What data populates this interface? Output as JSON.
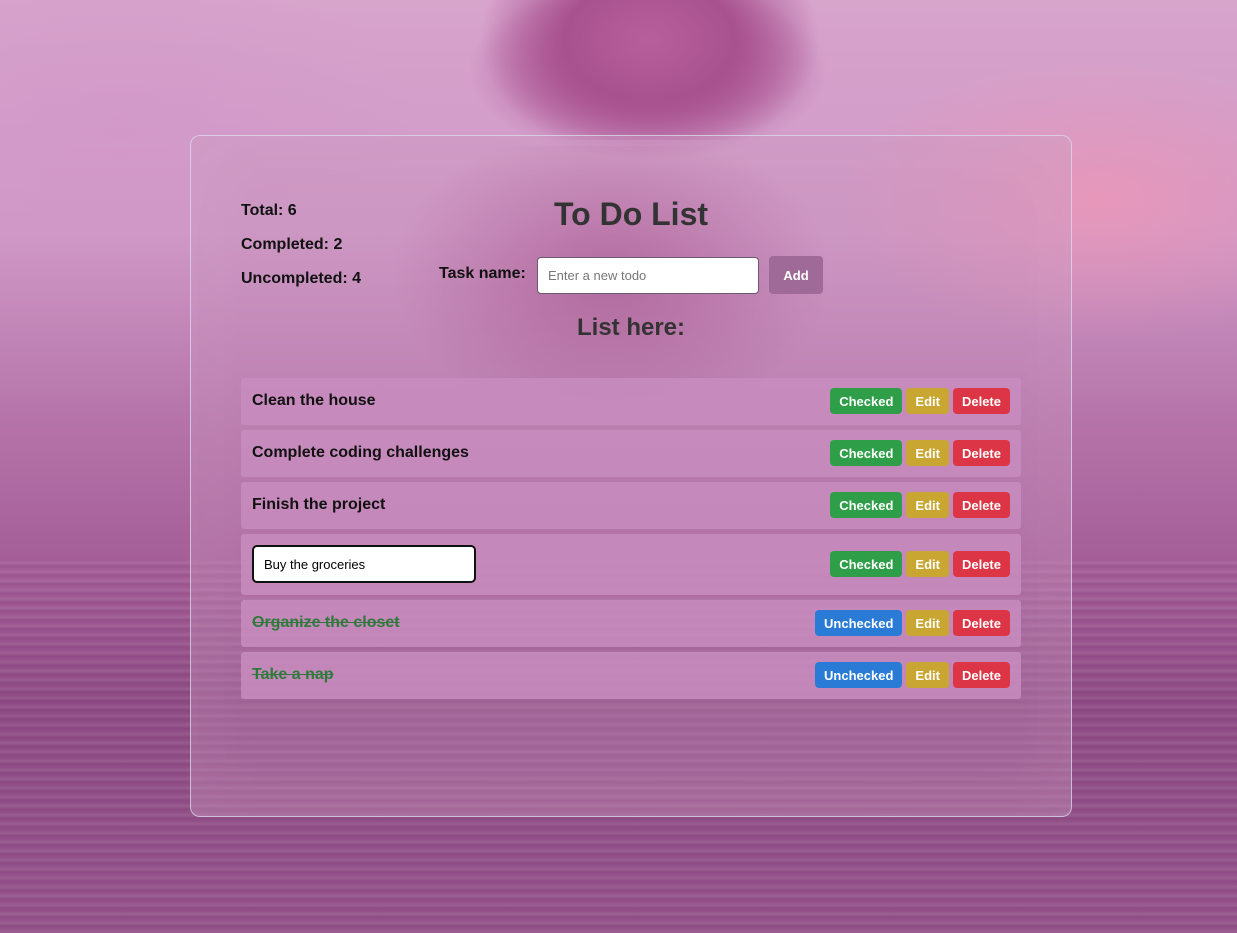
{
  "stats": {
    "total": "Total: 6",
    "completed": "Completed: 2",
    "uncompleted": "Uncompleted: 4"
  },
  "title": "To Do List",
  "form": {
    "label": "Task name:",
    "placeholder": "Enter a new todo",
    "value": "",
    "add_label": "Add"
  },
  "list_heading": "List here:",
  "todos": [
    {
      "text": "Clean the house",
      "done": false,
      "editing": false,
      "toggle_label": "Checked",
      "edit_label": "Edit",
      "delete_label": "Delete"
    },
    {
      "text": "Complete coding challenges",
      "done": false,
      "editing": false,
      "toggle_label": "Checked",
      "edit_label": "Edit",
      "delete_label": "Delete"
    },
    {
      "text": "Finish the project",
      "done": false,
      "editing": false,
      "toggle_label": "Checked",
      "edit_label": "Edit",
      "delete_label": "Delete"
    },
    {
      "text": "Buy the groceries",
      "done": false,
      "editing": true,
      "toggle_label": "Checked",
      "edit_label": "Edit",
      "delete_label": "Delete"
    },
    {
      "text": "Organize the closet",
      "done": true,
      "editing": false,
      "toggle_label": "Unchecked",
      "edit_label": "Edit",
      "delete_label": "Delete"
    },
    {
      "text": "Take a nap",
      "done": true,
      "editing": false,
      "toggle_label": "Unchecked",
      "edit_label": "Edit",
      "delete_label": "Delete"
    }
  ],
  "colors": {
    "checked": "#2e9e48",
    "unchecked": "#2a7bd6",
    "edit": "#c9a631",
    "delete": "#dc3545",
    "add": "#a06a98",
    "done_text": "#2e7a3a"
  }
}
